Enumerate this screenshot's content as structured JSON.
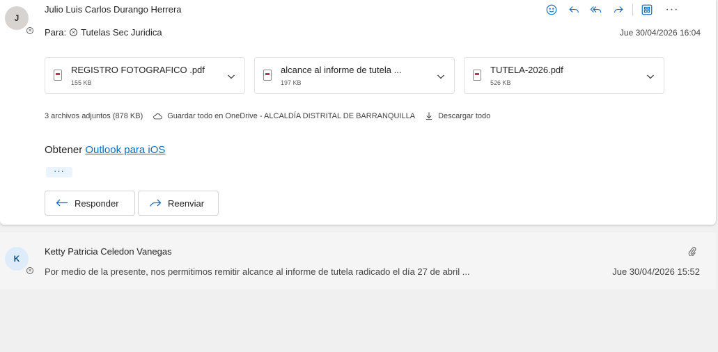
{
  "message1": {
    "avatar_initial": "J",
    "sender": "Julio Luis Carlos Durango Herrera",
    "to_label": "Para:",
    "to_recipient": "Tutelas Sec Juridica",
    "date": "Jue 30/04/2026 16:04",
    "toolbar": {
      "icons": [
        "emoji-icon",
        "reply-icon",
        "reply-all-icon",
        "forward-icon",
        "apps-icon",
        "more-icon"
      ],
      "more_label": "···"
    },
    "attachments": [
      {
        "name": "REGISTRO FOTOGRAFICO .pdf",
        "size": "155 KB",
        "icon": "pdf-file-icon"
      },
      {
        "name": "alcance al informe de tutela ...",
        "size": "197 KB",
        "icon": "pdf-file-icon"
      },
      {
        "name": "TUTELA-2026.pdf",
        "size": "526 KB",
        "icon": "pdf-file-icon"
      }
    ],
    "attachments_summary": "3 archivos adjuntos (878 KB)",
    "save_all_label": "Guardar todo en OneDrive - ALCALDÍA DISTRITAL DE BARRANQUILLA",
    "download_all_label": "Descargar todo",
    "body_prefix": "Obtener ",
    "body_link": "Outlook para iOS",
    "expand_label": "···",
    "reply_label": "Responder",
    "forward_label": "Reenviar"
  },
  "message2": {
    "avatar_initial": "K",
    "sender": "Ketty Patricia Celedon Vanegas",
    "preview": "Por medio de la presente, nos permitimos remitir alcance al informe de tutela radicado el día 27 de abril ...",
    "date": "Jue 30/04/2026 15:52",
    "has_attachment_icon": "paperclip-icon"
  },
  "colors": {
    "accent": "#0f6cbd",
    "background": "#f0f0f0",
    "card": "#ffffff",
    "pdf_red": "#c4314b"
  }
}
